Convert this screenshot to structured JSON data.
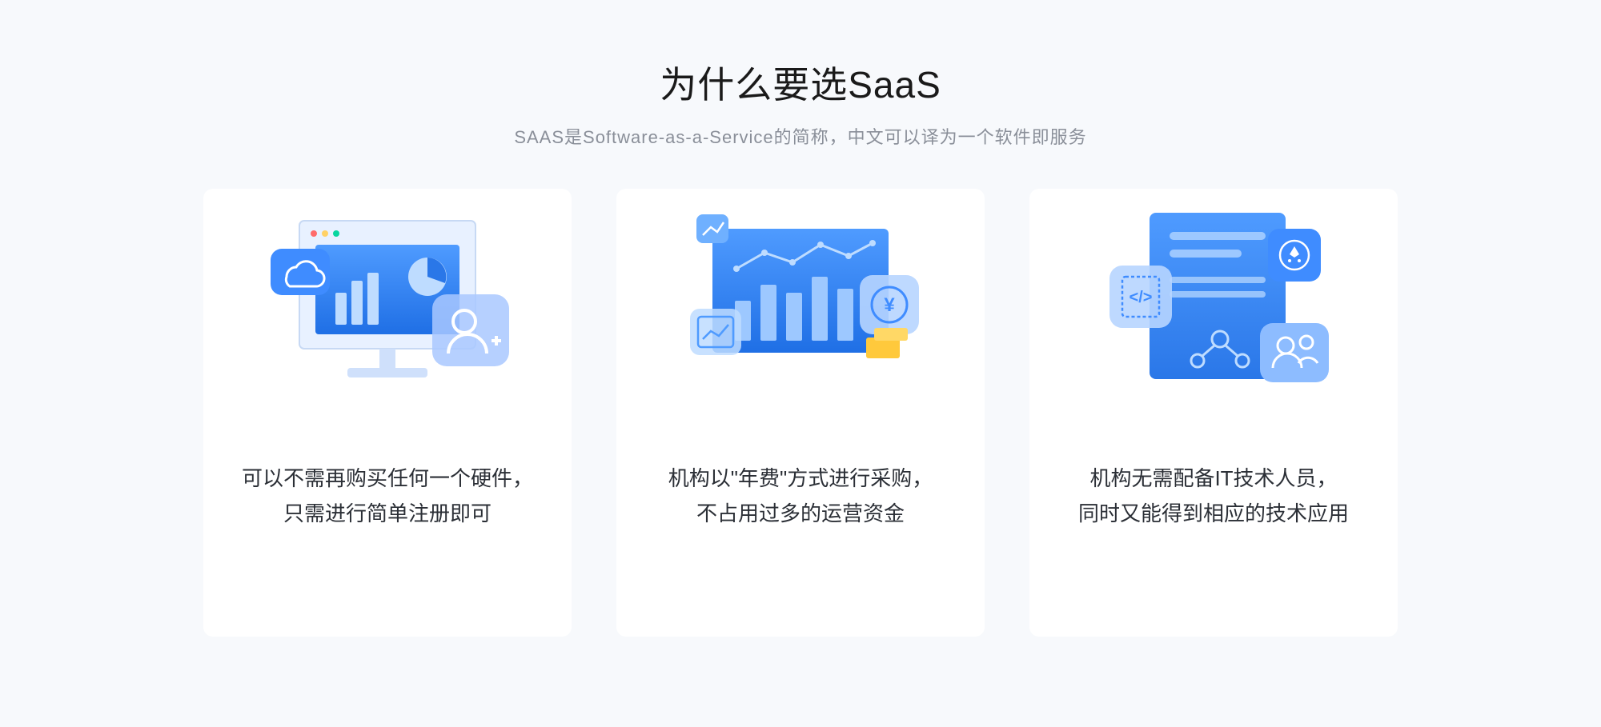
{
  "header": {
    "title": "为什么要选SaaS",
    "subtitle": "SAAS是Software-as-a-Service的简称，中文可以译为一个软件即服务"
  },
  "cards": [
    {
      "line1": "可以不需再购买任何一个硬件，",
      "line2": "只需进行简单注册即可",
      "icon": "monitor-dashboard"
    },
    {
      "line1": "机构以\"年费\"方式进行采购，",
      "line2": "不占用过多的运营资金",
      "icon": "chart-finance"
    },
    {
      "line1": "机构无需配备IT技术人员，",
      "line2": "同时又能得到相应的技术应用",
      "icon": "document-share"
    }
  ]
}
